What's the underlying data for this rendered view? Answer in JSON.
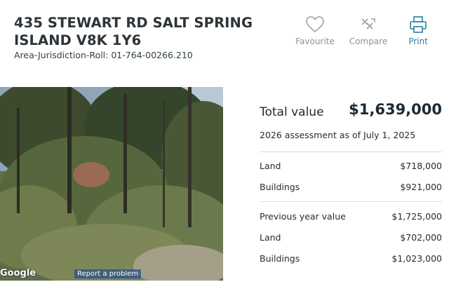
{
  "property": {
    "address": "435 STEWART RD SALT SPRING ISLAND V8K 1Y6",
    "roll_label": "Area-Jurisdiction-Roll:",
    "roll_value": "01-764-00266.210"
  },
  "actions": {
    "favourite": "Favourite",
    "compare": "Compare",
    "print": "Print"
  },
  "photo": {
    "logo": "Google",
    "report": "Report a problem"
  },
  "assessment": {
    "total_label": "Total value",
    "total_value": "$1,639,000",
    "assessment_note": "2026 assessment as of July 1, 2025",
    "land_label": "Land",
    "land_value": "$718,000",
    "buildings_label": "Buildings",
    "buildings_value": "$921,000",
    "previous_label": "Previous year value",
    "previous_value": "$1,725,000",
    "prev_land_label": "Land",
    "prev_land_value": "$702,000",
    "prev_buildings_label": "Buildings",
    "prev_buildings_value": "$1,023,000"
  },
  "colors": {
    "accent": "#2a7fa5",
    "muted": "#8a9399"
  },
  "icons": [
    "heart-icon",
    "compare-icon",
    "printer-icon"
  ]
}
